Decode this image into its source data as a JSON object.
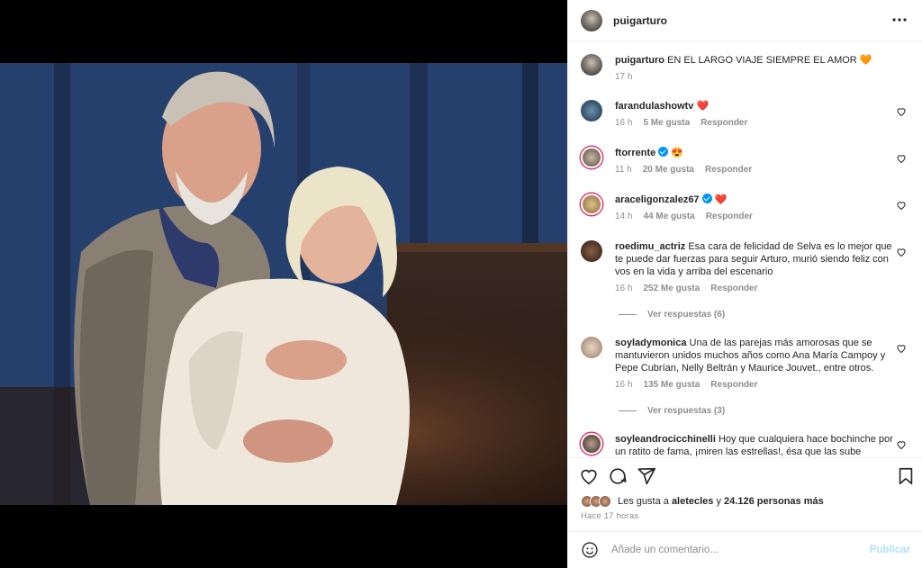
{
  "post": {
    "author": "puigarturo",
    "caption": "EN EL LARGO VIAJE SIEMPRE EL AMOR 🧡",
    "caption_time": "17 h"
  },
  "comments": [
    {
      "user": "farandulashowtv",
      "text": "❤️",
      "verified": false,
      "time": "16 h",
      "likes": "5 Me gusta",
      "reply": "Responder"
    },
    {
      "user": "ftorrente",
      "text": "😍",
      "verified": true,
      "time": "11 h",
      "likes": "20 Me gusta",
      "reply": "Responder"
    },
    {
      "user": "araceligonzalez67",
      "text": "❤️",
      "verified": true,
      "time": "14 h",
      "likes": "44 Me gusta",
      "reply": "Responder"
    },
    {
      "user": "roedimu_actriz",
      "text": "Esa cara de felicidad de Selva es lo mejor que te puede dar fuerzas para seguir Arturo, murió siendo feliz con vos en la vida y arriba del escenario",
      "verified": false,
      "time": "16 h",
      "likes": "252 Me gusta",
      "reply": "Responder",
      "view_replies": "Ver respuestas (6)"
    },
    {
      "user": "soyladymonica",
      "text": "Una de las parejas más amorosas que se mantuvieron unidos muchos años como Ana María Campoy y Pepe Cubrían, Nelly Beltrán y Maurice Jouvet., entre otros.",
      "verified": false,
      "time": "16 h",
      "likes": "135 Me gusta",
      "reply": "Responder",
      "view_replies": "Ver respuestas (3)"
    },
    {
      "user": "soyleandrocicchinelli",
      "text": "Hoy que cualquiera hace bochinche por un ratito de fama, ¡miren las estrellas!, ésa que las sube",
      "verified": false
    }
  ],
  "footer": {
    "likes_prefix": "Les gusta a",
    "likes_user": "aletecles",
    "likes_joiner": "y",
    "likes_count": "24.126 personas más",
    "posted_ago": "Hace 17 horas",
    "comment_placeholder": "Añade un comentario...",
    "publish_label": "Publicar"
  },
  "icons": {
    "more": "more-horizontal-icon",
    "like": "heart-icon",
    "comment": "comment-icon",
    "share": "paper-plane-icon",
    "save": "bookmark-icon",
    "emoji": "smiley-icon"
  },
  "colors": {
    "accent": "#0095f6",
    "heart": "#ed4956",
    "muted": "#8e8e8e",
    "publish_disabled": "#b2dffc"
  }
}
